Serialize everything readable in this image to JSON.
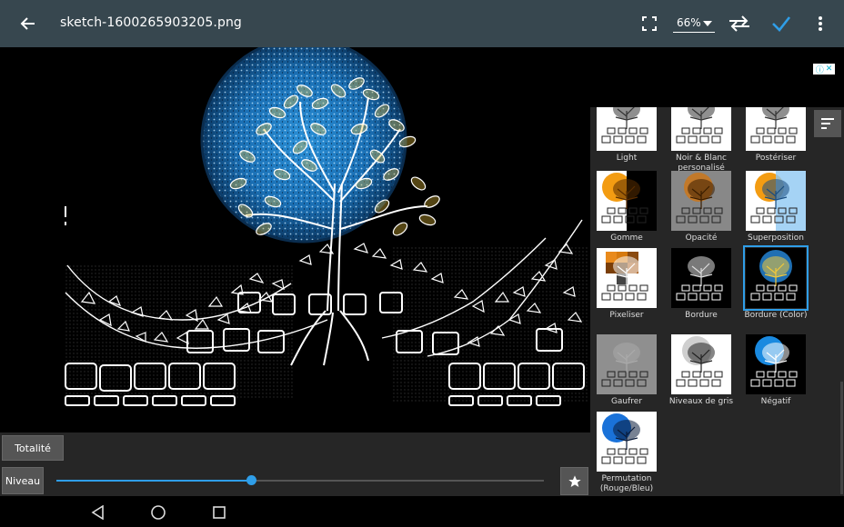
{
  "header": {
    "file_name": "sketch-1600265903205.png",
    "zoom": "66%",
    "icons": [
      "back-arrow-icon",
      "fit-screen-icon",
      "swap-icon",
      "check-icon",
      "more-vert-icon"
    ]
  },
  "filters": [
    {
      "label": "Light",
      "variant": "partial-orange"
    },
    {
      "label": "Noir & Blanc personalisé",
      "variant": "partial-orange"
    },
    {
      "label": "Postériser",
      "variant": "partial-orange"
    },
    {
      "label": "Gomme",
      "variant": "gomme"
    },
    {
      "label": "Opacité",
      "variant": "opacite"
    },
    {
      "label": "Superposition",
      "variant": "superposition"
    },
    {
      "label": "Pixeliser",
      "variant": "pixeliser"
    },
    {
      "label": "Bordure",
      "variant": "bordure"
    },
    {
      "label": "Bordure (Color)",
      "variant": "bordure-color",
      "selected": true
    },
    {
      "label": "Gaufrer",
      "variant": "gaufrer"
    },
    {
      "label": "Niveaux de gris",
      "variant": "gris"
    },
    {
      "label": "Négatif",
      "variant": "negatif"
    },
    {
      "label": "Permutation (Rouge/Bleu)",
      "variant": "permutation"
    }
  ],
  "controls": {
    "total_label": "Totalité",
    "level_label": "Niveau",
    "level_value": 0.4
  },
  "colors": {
    "accent": "#2f9ee8",
    "toolbar": "#37474f",
    "panel": "#262626"
  }
}
